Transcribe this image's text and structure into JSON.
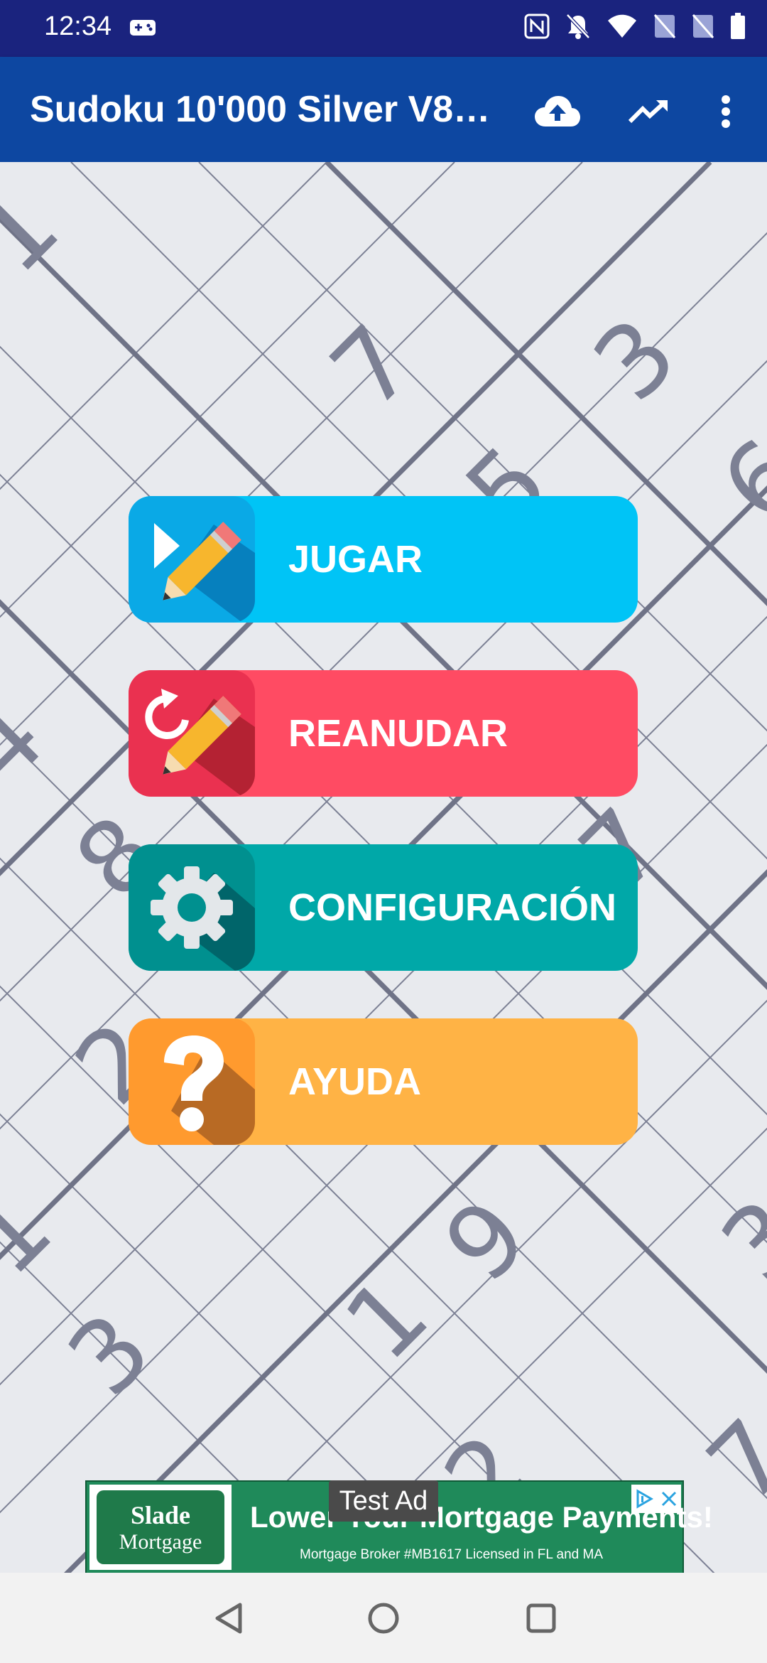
{
  "status_bar": {
    "time": "12:34",
    "icons": [
      "gamepad-icon",
      "nfc-icon",
      "mute-icon",
      "wifi-icon",
      "signal-icon",
      "signal-icon",
      "battery-icon"
    ]
  },
  "app_bar": {
    "title": "Sudoku 10'000 Silver V8.0...",
    "actions": [
      "cloud-upload-icon",
      "trending-up-icon",
      "more-vert-icon"
    ]
  },
  "board": {
    "digits": [
      "1",
      "7",
      "3",
      "6",
      "5",
      "4",
      "4",
      "8",
      "7",
      "2",
      "2",
      "3",
      "1",
      "9",
      "1",
      "3",
      "2",
      "7"
    ]
  },
  "menu": {
    "play": {
      "label": "JUGAR",
      "color": "#00c4f6",
      "icon_bg": "#0aa9e6"
    },
    "resume": {
      "label": "REANUDAR",
      "color": "#ff4b63",
      "icon_bg": "#ea3150"
    },
    "settings": {
      "label": "CONFIGURACIÓN",
      "color": "#00a8a8",
      "icon_bg": "#00908f"
    },
    "help": {
      "label": "AYUDA",
      "color": "#ffb345",
      "icon_bg": "#ff9a2e"
    }
  },
  "ad": {
    "tag": "Test Ad",
    "logo_line1": "Slade",
    "logo_line2": "Mortgage",
    "headline": "Lower Your Mortgage Payments!",
    "subtext": "Mortgage Broker #MB1617  Licensed in FL and MA"
  },
  "nav_bar": {
    "buttons": [
      "back-icon",
      "home-icon",
      "recents-icon"
    ]
  }
}
